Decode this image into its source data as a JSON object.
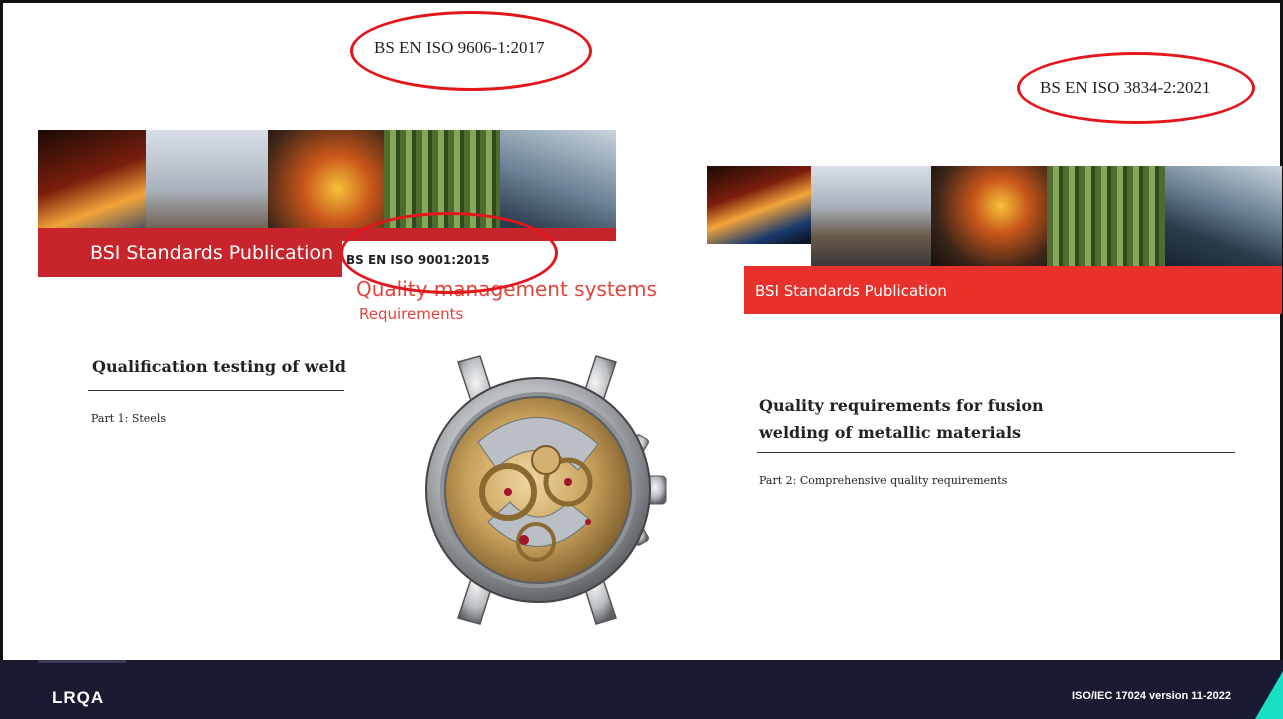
{
  "annotations": {
    "label_left": "BS EN ISO 9606-1:2017",
    "label_right": "BS EN ISO 3834-2:2021"
  },
  "cover_left": {
    "banner_text": "BSI Standards Publication",
    "title": "Qualification testing of weld",
    "part": "Part 1: Steels"
  },
  "cover_center": {
    "standard": "BS EN ISO 9001:2015",
    "title": "Quality management systems",
    "subtitle": "Requirements"
  },
  "cover_right": {
    "banner_text": "BSI Standards Publication",
    "title_line1": "Quality requirements for fusion",
    "title_line2": "welding of metallic materials",
    "part": "Part 2: Comprehensive quality requirements"
  },
  "footer": {
    "logo": "LRQA",
    "version": "ISO/IEC 17024 version 11-2022"
  },
  "colors": {
    "bsi_red": "#c8242b",
    "bsi_red_bright": "#e8312a",
    "highlight_circle": "#e3161b",
    "footer_bg": "#1b1a33",
    "accent": "#19e0c2"
  }
}
